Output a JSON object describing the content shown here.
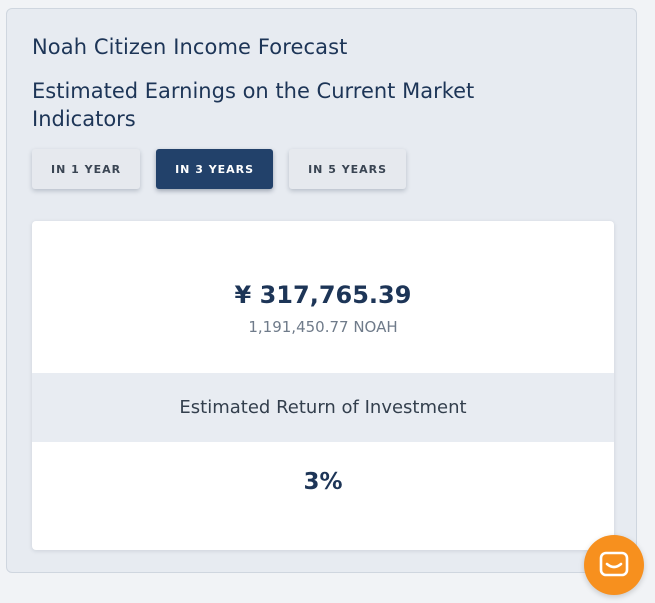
{
  "widget": {
    "title": "Noah Citizen Income Forecast",
    "subtitle": "Estimated Earnings on the Current Market Indicators"
  },
  "tabs": [
    {
      "label": "IN 1 YEAR",
      "active": false
    },
    {
      "label": "IN 3 YEARS",
      "active": true
    },
    {
      "label": "IN 5 YEARS",
      "active": false
    }
  ],
  "earnings": {
    "fiat_amount": "¥ 317,765.39",
    "token_amount": "1,191,450.77 NOAH"
  },
  "roi": {
    "label": "Estimated Return of Investment",
    "value": "3%"
  },
  "chat": {
    "icon": "chat-icon"
  },
  "colors": {
    "brand_navy": "#1d3557",
    "active_tab": "#22416a",
    "chat_orange": "#f7901e"
  }
}
